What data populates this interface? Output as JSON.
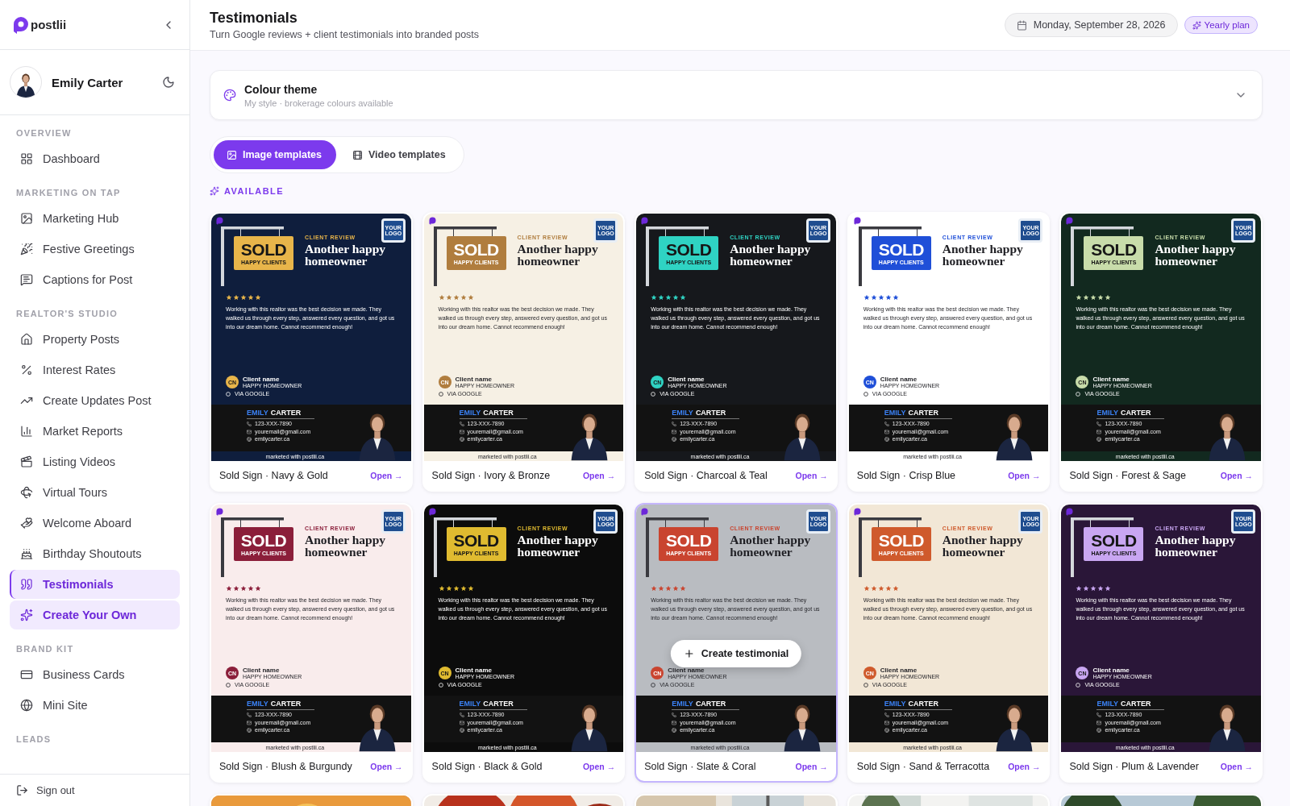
{
  "brand": {
    "name": "postlii"
  },
  "user": {
    "name": "Emily Carter"
  },
  "nav": [
    {
      "title": "OVERVIEW",
      "items": [
        {
          "label": "Dashboard",
          "selected": false,
          "featured": false
        }
      ]
    },
    {
      "title": "MARKETING ON TAP",
      "items": [
        {
          "label": "Marketing Hub",
          "selected": false,
          "featured": false
        },
        {
          "label": "Festive Greetings",
          "selected": false,
          "featured": false
        },
        {
          "label": "Captions for Post",
          "selected": false,
          "featured": false
        }
      ]
    },
    {
      "title": "REALTOR'S STUDIO",
      "items": [
        {
          "label": "Property Posts",
          "selected": false,
          "featured": false
        },
        {
          "label": "Interest Rates",
          "selected": false,
          "featured": false
        },
        {
          "label": "Create Updates Post",
          "selected": false,
          "featured": false
        },
        {
          "label": "Market Reports",
          "selected": false,
          "featured": false
        },
        {
          "label": "Listing Videos",
          "selected": false,
          "featured": false
        },
        {
          "label": "Virtual Tours",
          "selected": false,
          "featured": false
        },
        {
          "label": "Welcome Aboard",
          "selected": false,
          "featured": false
        },
        {
          "label": "Birthday Shoutouts",
          "selected": false,
          "featured": false
        },
        {
          "label": "Testimonials",
          "selected": true,
          "featured": false
        },
        {
          "label": "Create Your Own",
          "selected": false,
          "featured": true
        }
      ]
    },
    {
      "title": "BRAND KIT",
      "items": [
        {
          "label": "Business Cards",
          "selected": false,
          "featured": false
        },
        {
          "label": "Mini Site",
          "selected": false,
          "featured": false
        }
      ]
    },
    {
      "title": "LEADS"
    }
  ],
  "sign_out": "Sign out",
  "header": {
    "title": "Testimonials",
    "subtitle": "Turn Google reviews + client testimonials into branded posts",
    "date": "Monday, September 28, 2026",
    "plan": "Yearly plan"
  },
  "theme_panel": {
    "title": "Colour theme",
    "subtitle": "My style · brokerage colours available",
    "expanded": false
  },
  "template_tabs": [
    {
      "label": "Image templates",
      "selected": true
    },
    {
      "label": "Video templates",
      "selected": false
    }
  ],
  "section_label": "AVAILABLE",
  "hover_action": "Create testimonial",
  "templates": [
    {
      "kind": "sold_sign",
      "name": "Sold Sign · Navy & Gold",
      "open": "Open →",
      "selected": false,
      "background": {
        "color": "#0f1e3d"
      },
      "accent": {
        "color": "#e8b54a"
      },
      "logo": "YOUR LOGO",
      "sign": "SOLD",
      "sign_caption": "HAPPY CLIENTS",
      "eyebrow": "CLIENT REVIEW",
      "headline": "Another happy homeowner",
      "stars": 5,
      "review": "Working with this realtor was the best decision we made. They walked us through every step, answered every question, and got us into our dream home. Cannot recommend enough!",
      "initials": "CN",
      "client": "Client name",
      "client_role": "HAPPY HOMEOWNER",
      "source": "VIA GOOGLE",
      "agent_first": "EMILY",
      "agent_last": "CARTER",
      "phone": "123-XXX-7890",
      "email": "youremail@gmail.com",
      "website": "emilycarter.ca",
      "footer": "marketed with postlii.ca"
    },
    {
      "kind": "sold_sign",
      "name": "Sold Sign · Ivory & Bronze",
      "open": "Open →",
      "selected": false,
      "background": {
        "color": "#f6f0e4"
      },
      "accent": {
        "color": "#b07d3e"
      },
      "logo": "YOUR LOGO",
      "sign": "SOLD",
      "sign_caption": "HAPPY CLIENTS",
      "eyebrow": "CLIENT REVIEW",
      "headline": "Another happy homeowner",
      "stars": 5,
      "review": "Working with this realtor was the best decision we made. They walked us through every step, answered every question, and got us into our dream home. Cannot recommend enough!",
      "initials": "CN",
      "client": "Client name",
      "client_role": "HAPPY HOMEOWNER",
      "source": "VIA GOOGLE",
      "agent_first": "EMILY",
      "agent_last": "CARTER",
      "phone": "123-XXX-7890",
      "email": "youremail@gmail.com",
      "website": "emilycarter.ca",
      "footer": "marketed with postlii.ca"
    },
    {
      "kind": "sold_sign",
      "name": "Sold Sign · Charcoal & Teal",
      "open": "Open →",
      "selected": false,
      "background": {
        "color": "#16181c"
      },
      "accent": {
        "color": "#2fd3c3"
      },
      "logo": "YOUR LOGO",
      "sign": "SOLD",
      "sign_caption": "HAPPY CLIENTS",
      "eyebrow": "CLIENT REVIEW",
      "headline": "Another happy homeowner",
      "stars": 5,
      "review": "Working with this realtor was the best decision we made. They walked us through every step, answered every question, and got us into our dream home. Cannot recommend enough!",
      "initials": "CN",
      "client": "Client name",
      "client_role": "HAPPY HOMEOWNER",
      "source": "VIA GOOGLE",
      "agent_first": "EMILY",
      "agent_last": "CARTER",
      "phone": "123-XXX-7890",
      "email": "youremail@gmail.com",
      "website": "emilycarter.ca",
      "footer": "marketed with postlii.ca"
    },
    {
      "kind": "sold_sign",
      "name": "Sold Sign · Crisp Blue",
      "open": "Open →",
      "selected": false,
      "background": {
        "color": "#ffffff"
      },
      "accent": {
        "color": "#1f4fd8"
      },
      "logo": "YOUR LOGO",
      "sign": "SOLD",
      "sign_caption": "HAPPY CLIENTS",
      "eyebrow": "CLIENT REVIEW",
      "headline": "Another happy homeowner",
      "stars": 5,
      "review": "Working with this realtor was the best decision we made. They walked us through every step, answered every question, and got us into our dream home. Cannot recommend enough!",
      "initials": "CN",
      "client": "Client name",
      "client_role": "HAPPY HOMEOWNER",
      "source": "VIA GOOGLE",
      "agent_first": "EMILY",
      "agent_last": "CARTER",
      "phone": "123-XXX-7890",
      "email": "youremail@gmail.com",
      "website": "emilycarter.ca",
      "footer": "marketed with postlii.ca"
    },
    {
      "kind": "sold_sign",
      "name": "Sold Sign · Forest & Sage",
      "open": "Open →",
      "selected": false,
      "background": {
        "color": "#12291f"
      },
      "accent": {
        "color": "#c8dcaa"
      },
      "logo": "YOUR LOGO",
      "sign": "SOLD",
      "sign_caption": "HAPPY CLIENTS",
      "eyebrow": "CLIENT REVIEW",
      "headline": "Another happy homeowner",
      "stars": 5,
      "review": "Working with this realtor was the best decision we made. They walked us through every step, answered every question, and got us into our dream home. Cannot recommend enough!",
      "initials": "CN",
      "client": "Client name",
      "client_role": "HAPPY HOMEOWNER",
      "source": "VIA GOOGLE",
      "agent_first": "EMILY",
      "agent_last": "CARTER",
      "phone": "123-XXX-7890",
      "email": "youremail@gmail.com",
      "website": "emilycarter.ca",
      "footer": "marketed with postlii.ca"
    },
    {
      "kind": "sold_sign",
      "name": "Sold Sign · Blush & Burgundy",
      "open": "Open →",
      "selected": false,
      "background": {
        "color": "#f9ecec"
      },
      "accent": {
        "color": "#8b1e3a"
      },
      "logo": "YOUR LOGO",
      "sign": "SOLD",
      "sign_caption": "HAPPY CLIENTS",
      "eyebrow": "CLIENT REVIEW",
      "headline": "Another happy homeowner",
      "stars": 5,
      "review": "Working with this realtor was the best decision we made. They walked us through every step, answered every question, and got us into our dream home. Cannot recommend enough!",
      "initials": "CN",
      "client": "Client name",
      "client_role": "HAPPY HOMEOWNER",
      "source": "VIA GOOGLE",
      "agent_first": "EMILY",
      "agent_last": "CARTER",
      "phone": "123-XXX-7890",
      "email": "youremail@gmail.com",
      "website": "emilycarter.ca",
      "footer": "marketed with postlii.ca"
    },
    {
      "kind": "sold_sign",
      "name": "Sold Sign · Black & Gold",
      "open": "Open →",
      "selected": false,
      "background": {
        "color": "#0c0c0c"
      },
      "accent": {
        "color": "#e0bb30"
      },
      "logo": "YOUR LOGO",
      "sign": "SOLD",
      "sign_caption": "HAPPY CLIENTS",
      "eyebrow": "CLIENT REVIEW",
      "headline": "Another happy homeowner",
      "stars": 5,
      "review": "Working with this realtor was the best decision we made. They walked us through every step, answered every question, and got us into our dream home. Cannot recommend enough!",
      "initials": "CN",
      "client": "Client name",
      "client_role": "HAPPY HOMEOWNER",
      "source": "VIA GOOGLE",
      "agent_first": "EMILY",
      "agent_last": "CARTER",
      "phone": "123-XXX-7890",
      "email": "youremail@gmail.com",
      "website": "emilycarter.ca",
      "footer": "marketed with postlii.ca"
    },
    {
      "kind": "sold_sign",
      "name": "Sold Sign · Slate & Coral",
      "open": "Open →",
      "selected": true,
      "background": {
        "color": "#b9bcc1"
      },
      "accent": {
        "color": "#c9442f"
      },
      "logo": "YOUR LOGO",
      "sign": "SOLD",
      "sign_caption": "HAPPY CLIENTS",
      "eyebrow": "CLIENT REVIEW",
      "headline": "Another happy homeowner",
      "stars": 5,
      "review": "Working with this realtor was the best decision we made. They walked us through every step, answered every question, and got us into our dream home. Cannot recommend enough!",
      "initials": "CN",
      "client": "Client name",
      "client_role": "HAPPY HOMEOWNER",
      "source": "VIA GOOGLE",
      "agent_first": "EMILY",
      "agent_last": "CARTER",
      "phone": "123-XXX-7890",
      "email": "youremail@gmail.com",
      "website": "emilycarter.ca",
      "footer": "marketed with postlii.ca"
    },
    {
      "kind": "sold_sign",
      "name": "Sold Sign · Sand & Terracotta",
      "open": "Open →",
      "selected": false,
      "background": {
        "color": "#f2e7d6"
      },
      "accent": {
        "color": "#cf5a2c"
      },
      "logo": "YOUR LOGO",
      "sign": "SOLD",
      "sign_caption": "HAPPY CLIENTS",
      "eyebrow": "CLIENT REVIEW",
      "headline": "Another happy homeowner",
      "stars": 5,
      "review": "Working with this realtor was the best decision we made. They walked us through every step, answered every question, and got us into our dream home. Cannot recommend enough!",
      "initials": "CN",
      "client": "Client name",
      "client_role": "HAPPY HOMEOWNER",
      "source": "VIA GOOGLE",
      "agent_first": "EMILY",
      "agent_last": "CARTER",
      "phone": "123-XXX-7890",
      "email": "youremail@gmail.com",
      "website": "emilycarter.ca",
      "footer": "marketed with postlii.ca"
    },
    {
      "kind": "sold_sign",
      "name": "Sold Sign · Plum & Lavender",
      "open": "Open →",
      "selected": false,
      "background": {
        "color": "#2a1638"
      },
      "accent": {
        "color": "#c9a6f2"
      },
      "logo": "YOUR LOGO",
      "sign": "SOLD",
      "sign_caption": "HAPPY CLIENTS",
      "eyebrow": "CLIENT REVIEW",
      "headline": "Another happy homeowner",
      "stars": 5,
      "review": "Working with this realtor was the best decision we made. They walked us through every step, answered every question, and got us into our dream home. Cannot recommend enough!",
      "initials": "CN",
      "client": "Client name",
      "client_role": "HAPPY HOMEOWNER",
      "source": "VIA GOOGLE",
      "agent_first": "EMILY",
      "agent_last": "CARTER",
      "phone": "123-XXX-7890",
      "email": "youremail@gmail.com",
      "website": "emilycarter.ca",
      "footer": "marketed with postlii.ca"
    },
    {
      "kind": "picture",
      "selected": false
    },
    {
      "kind": "picture",
      "selected": false
    },
    {
      "kind": "picture",
      "selected": false
    },
    {
      "kind": "picture",
      "selected": false
    },
    {
      "kind": "picture",
      "selected": false
    }
  ]
}
